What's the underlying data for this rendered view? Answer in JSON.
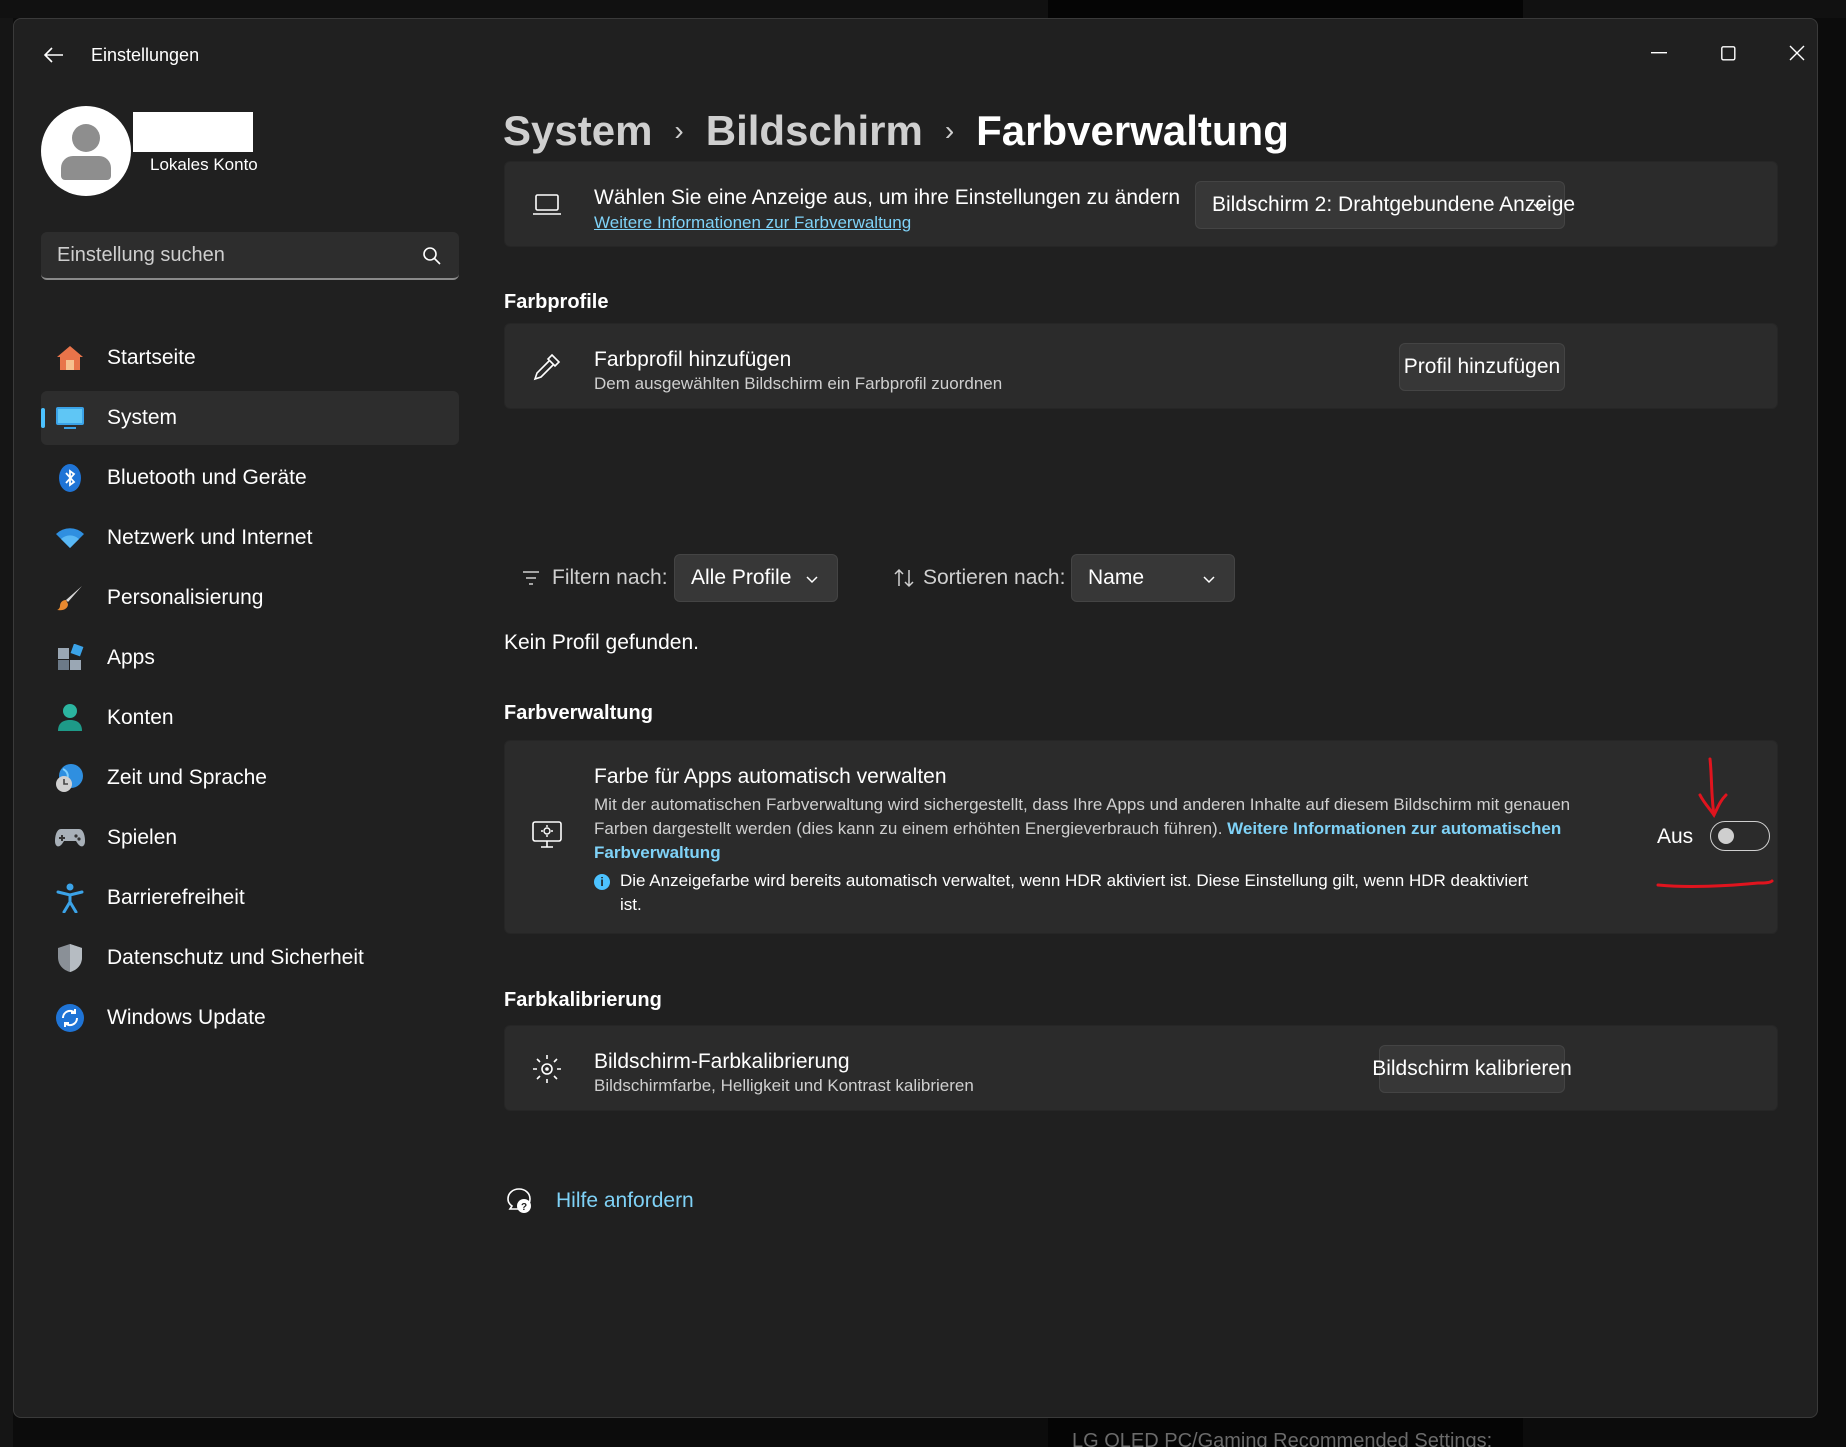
{
  "window": {
    "title": "Einstellungen"
  },
  "user": {
    "account_type": "Lokales Konto"
  },
  "search": {
    "placeholder": "Einstellung suchen"
  },
  "sidebar": {
    "items": [
      {
        "label": "Startseite",
        "icon": "home-icon"
      },
      {
        "label": "System",
        "icon": "monitor-icon",
        "active": true
      },
      {
        "label": "Bluetooth und Geräte",
        "icon": "bluetooth-icon"
      },
      {
        "label": "Netzwerk und Internet",
        "icon": "wifi-icon"
      },
      {
        "label": "Personalisierung",
        "icon": "brush-icon"
      },
      {
        "label": "Apps",
        "icon": "apps-icon"
      },
      {
        "label": "Konten",
        "icon": "person-icon"
      },
      {
        "label": "Zeit und Sprache",
        "icon": "globe-clock-icon"
      },
      {
        "label": "Spielen",
        "icon": "gamepad-icon"
      },
      {
        "label": "Barrierefreiheit",
        "icon": "accessibility-icon"
      },
      {
        "label": "Datenschutz und Sicherheit",
        "icon": "shield-icon"
      },
      {
        "label": "Windows Update",
        "icon": "update-icon"
      }
    ]
  },
  "breadcrumb": {
    "items": [
      "System",
      "Bildschirm",
      "Farbverwaltung"
    ]
  },
  "display_card": {
    "title": "Wählen Sie eine Anzeige aus, um ihre Einstellungen zu ändern",
    "link": "Weitere Informationen zur Farbverwaltung",
    "selected_display": "Bildschirm 2: Drahtgebundene Anzeige"
  },
  "profiles": {
    "section_title": "Farbprofile",
    "add_title": "Farbprofil hinzufügen",
    "add_sub": "Dem ausgewählten Bildschirm ein Farbprofil zuordnen",
    "add_button": "Profil hinzufügen",
    "filter_label": "Filtern nach:",
    "filter_value": "Alle Profile",
    "sort_label": "Sortieren nach:",
    "sort_value": "Name",
    "empty": "Kein Profil gefunden."
  },
  "color_management": {
    "section_title": "Farbverwaltung",
    "title": "Farbe für Apps automatisch verwalten",
    "desc": "Mit der automatischen Farbverwaltung wird sichergestellt, dass Ihre Apps und anderen Inhalte auf diesem Bildschirm mit genauen Farben dargestellt werden (dies kann zu einem erhöhten Energieverbrauch führen).",
    "desc_link": "Weitere Informationen zur automatischen Farbverwaltung",
    "info": "Die Anzeigefarbe wird bereits automatisch verwaltet, wenn HDR aktiviert ist. Diese Einstellung gilt, wenn HDR deaktiviert ist.",
    "toggle_label": "Aus",
    "toggle_on": false
  },
  "calibration": {
    "section_title": "Farbkalibrierung",
    "title": "Bildschirm-Farbkalibrierung",
    "sub": "Bildschirmfarbe, Helligkeit und Kontrast kalibrieren",
    "button": "Bildschirm kalibrieren"
  },
  "help": {
    "label": "Hilfe anfordern"
  },
  "background": {
    "bottom_text": "LG OLED PC/Gaming Recommended Settings:"
  },
  "colors": {
    "accent": "#4cc2ff",
    "link": "#7fd2f7",
    "window_bg": "#202020",
    "card_bg": "#2b2b2b",
    "annotation": "#e0141e"
  }
}
